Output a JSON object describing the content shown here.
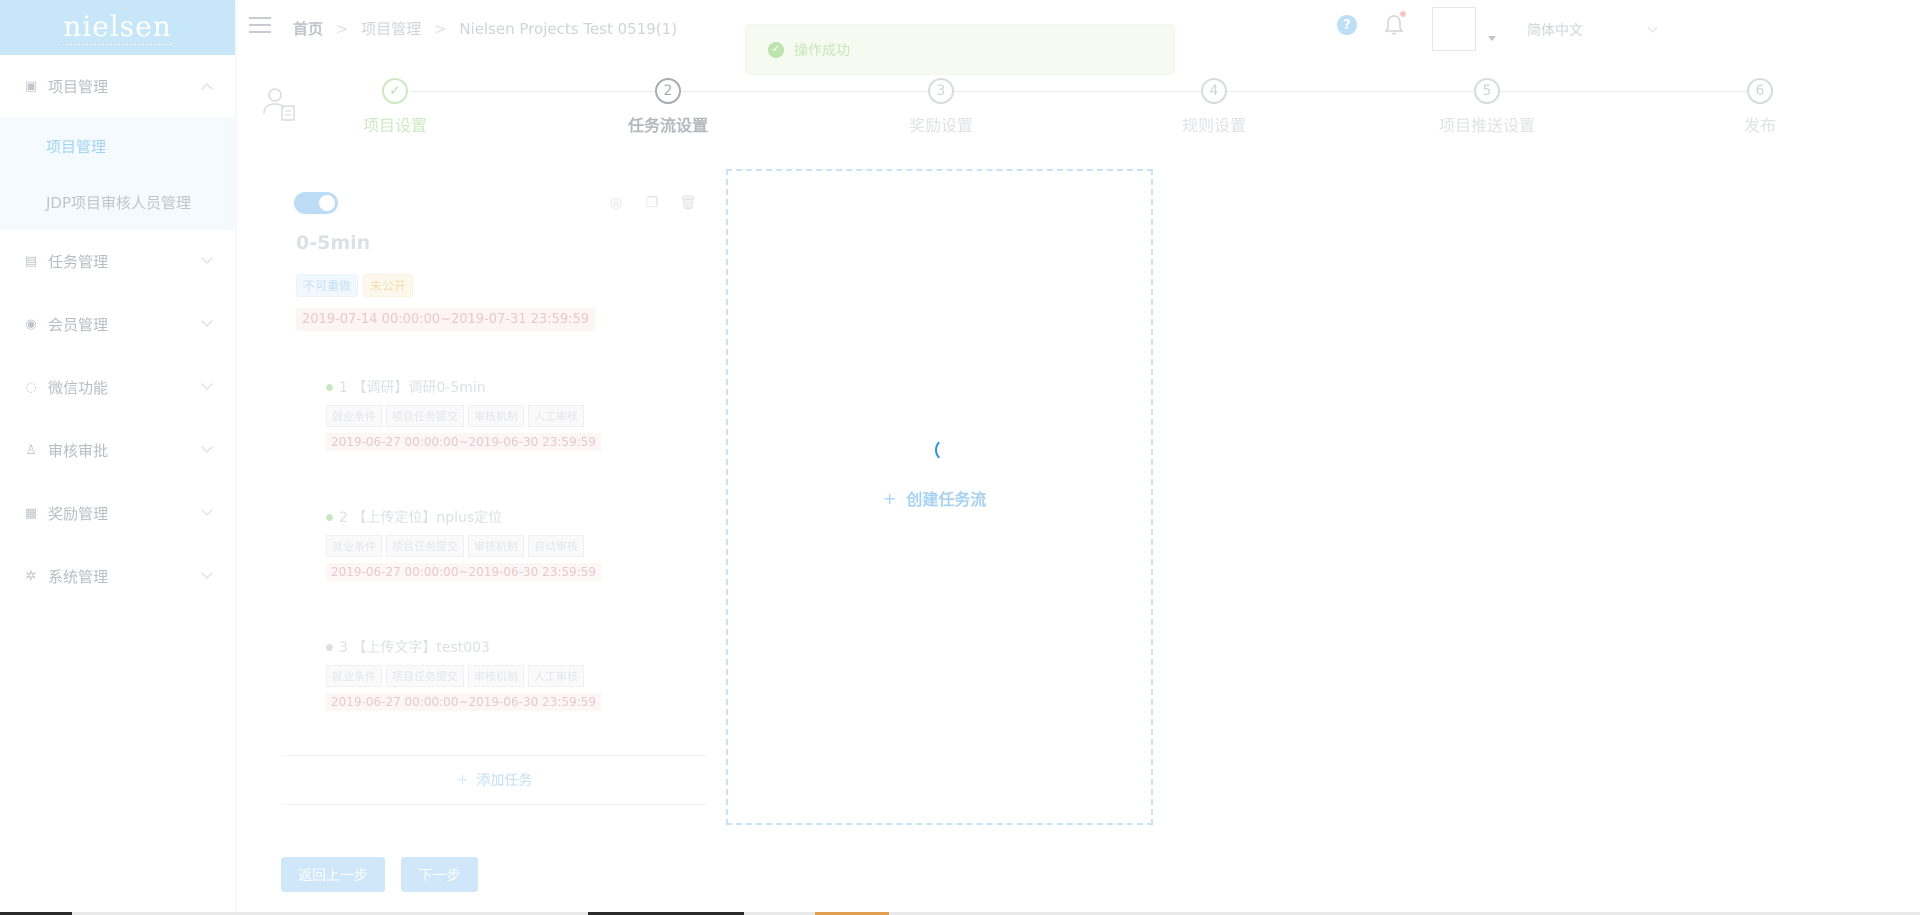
{
  "logo": {
    "text": "nielsen"
  },
  "sidebar": {
    "groups": [
      {
        "label": "项目管理",
        "icon": "folder-icon",
        "open": true,
        "items": [
          {
            "label": "项目管理",
            "active": true
          },
          {
            "label": "JDP项目审核人员管理",
            "active": false
          }
        ]
      },
      {
        "label": "任务管理",
        "icon": "calendar-icon",
        "open": false
      },
      {
        "label": "会员管理",
        "icon": "location-icon",
        "open": false
      },
      {
        "label": "微信功能",
        "icon": "wechat-icon",
        "open": false
      },
      {
        "label": "审核审批",
        "icon": "stamp-icon",
        "open": false
      },
      {
        "label": "奖励管理",
        "icon": "gift-icon",
        "open": false
      },
      {
        "label": "系统管理",
        "icon": "gear-icon",
        "open": false
      }
    ]
  },
  "header": {
    "breadcrumb": [
      "首页",
      "项目管理",
      "Nielsen Projects Test 0519(1)"
    ],
    "language": "简体中文",
    "has_notification": true
  },
  "toast": {
    "message": "操作成功",
    "type": "success"
  },
  "steps": [
    {
      "num": "✓",
      "label": "项目设置",
      "state": "done"
    },
    {
      "num": "2",
      "label": "任务流设置",
      "state": "current"
    },
    {
      "num": "3",
      "label": "奖励设置",
      "state": "pending"
    },
    {
      "num": "4",
      "label": "规则设置",
      "state": "pending"
    },
    {
      "num": "5",
      "label": "项目推送设置",
      "state": "pending"
    },
    {
      "num": "6",
      "label": "发布",
      "state": "pending"
    }
  ],
  "flow": {
    "enabled": true,
    "title": "0-5min",
    "tags": [
      {
        "text": "不可重做",
        "color": "blue"
      },
      {
        "text": "未公开",
        "color": "orange"
      }
    ],
    "date_range": "2019-07-14 00:00:00~2019-07-31 23:59:59",
    "tasks": [
      {
        "title": "1 【调研】调研0-5min",
        "chips": [
          "就业条件",
          "项目任务提交",
          "审核机制",
          "人工审核"
        ],
        "date": "2019-06-27 00:00:00~2019-06-30 23:59:59",
        "dot": "green"
      },
      {
        "title": "2 【上传定位】nplus定位",
        "chips": [
          "就业条件",
          "项目任务提交",
          "审核机制",
          "自动审核"
        ],
        "date": "2019-06-27 00:00:00~2019-06-30 23:59:59",
        "dot": "green"
      },
      {
        "title": "3 【上传文字】test003",
        "chips": [
          "就业条件",
          "项目任务提交",
          "审核机制",
          "人工审核"
        ],
        "date": "2019-06-27 00:00:00~2019-06-30 23:59:59",
        "dot": "grey"
      }
    ],
    "add_task": "添加任务"
  },
  "create_flow": {
    "label": "创建任务流",
    "loading": true
  },
  "buttons": {
    "prev": "返回上一步",
    "next": "下一步"
  },
  "colors": {
    "accent": "#2a92e0",
    "success": "#67c23a"
  }
}
